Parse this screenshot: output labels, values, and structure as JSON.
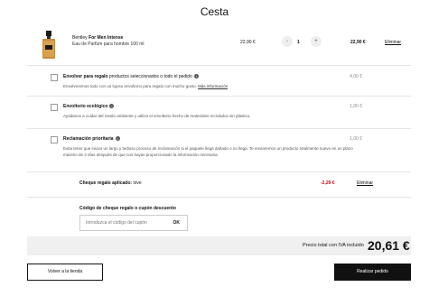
{
  "page": {
    "title": "Cesta"
  },
  "product": {
    "brand": "Bentley",
    "name": "For Men Intense",
    "description": "Eau de Parfum para hombre 100 ml",
    "unit_price": "22,90 €",
    "quantity": "1",
    "minus_label": "-",
    "plus_label": "+",
    "line_total": "22,90 €",
    "remove_label": "Eliminar"
  },
  "options": [
    {
      "title_bold": "Envolver para regalo",
      "title_rest": " productos seleccionados o todo el pedido",
      "description": "Envolveremos todo con un lujoso envoltorio para regalo con mucho gusto. ",
      "link": "Más información",
      "price": "4,00 €"
    },
    {
      "title_bold": "Envoltorio ecológico",
      "title_rest": "",
      "description": "Ayúdanos a cuidar del medio ambiente y utiliza el envoltorio hecho de materiales reciclados sin plástico.",
      "link": "",
      "price": "1,00 €"
    },
    {
      "title_bold": "Reclamación prioritaria",
      "title_rest": "",
      "description": "Evita tener que iniciar un largo y tedioso proceso de reclamación si el paquete llega dañado o no llega. Te enviaremos un producto totalmente nuevo en un plazo máximo de 3 días después de que nos hayas proporcionado la información necesaria.",
      "link": "",
      "price": "1,00 €"
    }
  ],
  "voucher": {
    "label_bold": "Cheque regalo aplicado:",
    "label_code": " love",
    "value": "-2,29 €",
    "remove_label": "Eliminar"
  },
  "coupon": {
    "title": "Código de cheque regalo o cupón descuento",
    "placeholder": "Introduzca el código del cupón",
    "ok_label": "OK"
  },
  "total": {
    "label": "Precio total con IVA incluido",
    "value": "20,61 €"
  },
  "buttons": {
    "back": "Volver a la tienda",
    "order": "Realizar pedido"
  },
  "icons": {
    "info": "info-icon",
    "product": "perfume-bottle-image"
  },
  "colors": {
    "discount": "#d0021b",
    "primary_button": "#111111",
    "total_bar": "#f0f0f0"
  }
}
